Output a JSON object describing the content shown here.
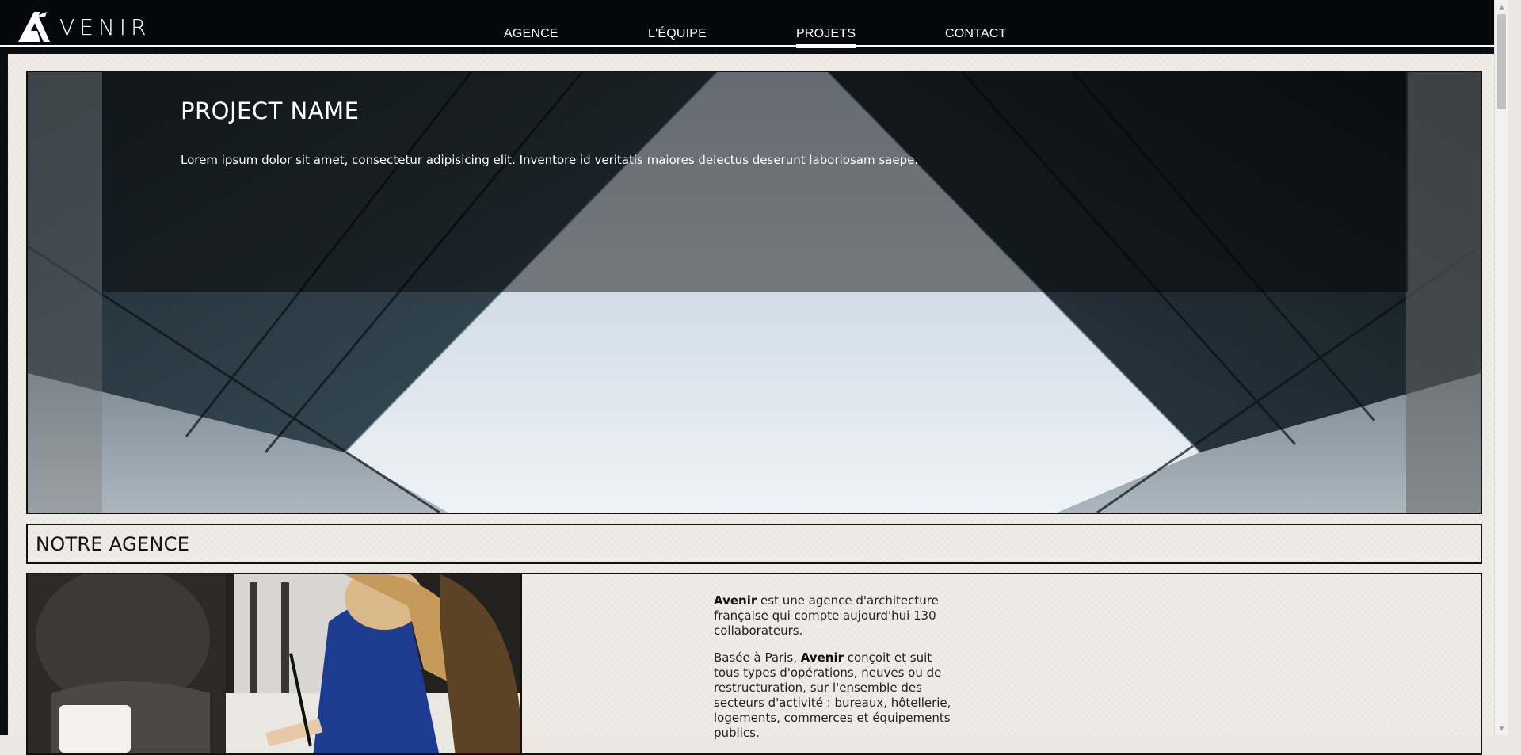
{
  "brand": {
    "logo_text": "VENIR",
    "logo_icon": "avenir-logo-icon"
  },
  "nav": {
    "items": [
      {
        "label": "AGENCE",
        "active": false
      },
      {
        "label": "L'ÉQUIPE",
        "active": false
      },
      {
        "label": "PROJETS",
        "active": true
      },
      {
        "label": "CONTACT",
        "active": false
      }
    ]
  },
  "hero": {
    "title": "PROJECT NAME",
    "description": "Lorem ipsum dolor sit amet, consectetur adipisicing elit. Inventore id veritatis maiores delectus deserunt laboriosam saepe."
  },
  "agency": {
    "heading": "NOTRE AGENCE",
    "p1_brand": "Avenir",
    "p1_rest": " est une agence d'architecture française qui compte aujourd'hui 130 collaborateurs.",
    "p2_start": "Basée à Paris, ",
    "p2_brand": "Avenir",
    "p2_rest": " conçoit et suit tous types d'opérations, neuves ou de restructuration, sur l'ensemble des secteurs d'activité : bureaux, hôtellerie, logements, commerces et équipements publics."
  },
  "colors": {
    "header_bg": "#05070a",
    "content_bg": "#f0ece7",
    "text_dark": "#111111",
    "text_light": "#ffffff"
  }
}
